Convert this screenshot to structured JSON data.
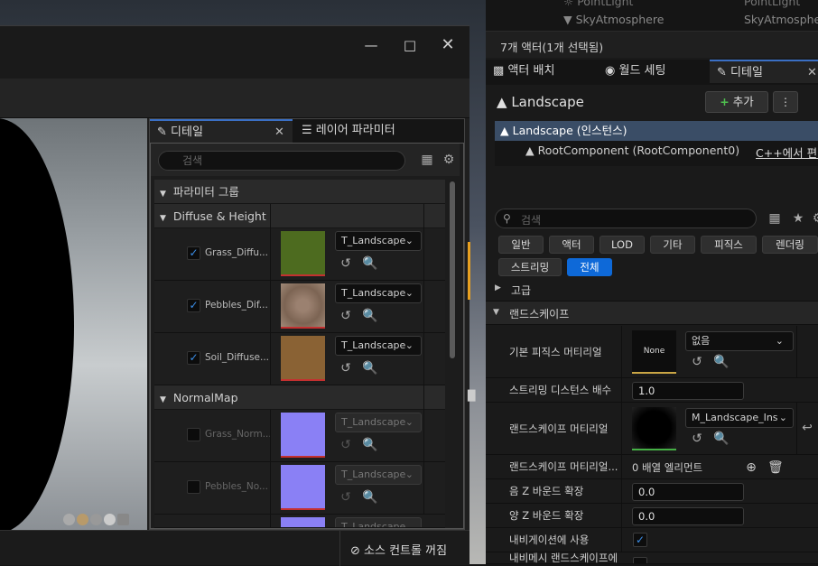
{
  "outliner": {
    "top_items": [
      {
        "name": "PointLight",
        "type": "PointLight"
      },
      {
        "name": "SkyAtmosphere",
        "type": "SkyAtmospher"
      }
    ],
    "status": "7개 액터(1개 선택됨)"
  },
  "right_tabs": [
    {
      "label": "액터 배치",
      "icon": "actor-place-icon"
    },
    {
      "label": "월드 세팅",
      "icon": "globe-icon"
    },
    {
      "label": "디테일",
      "icon": "pencil-icon"
    }
  ],
  "right_header": {
    "title": "Landscape",
    "add_label": "추가"
  },
  "component_tree": {
    "root": "Landscape (인스턴스)",
    "child": "RootComponent (RootComponent0)",
    "edit_link": "C++에서 편집"
  },
  "right_search": {
    "placeholder": "검색"
  },
  "filter_pills": {
    "row1": [
      "일반",
      "액터",
      "LOD",
      "기타",
      "피직스",
      "렌더링"
    ],
    "row2": [
      "스트리밍",
      "전체"
    ],
    "selected": "전체"
  },
  "sections": {
    "advanced": "고급",
    "landscape": "랜드스케이프"
  },
  "properties": [
    {
      "label": "기본 피직스 머티리얼",
      "thumb_text": "None",
      "value": "없음"
    },
    {
      "label": "스트리밍 디스턴스 배수",
      "value": "1.0"
    },
    {
      "label": "랜드스케이프 머티리얼",
      "value": "M_Landscape_Ins"
    },
    {
      "label": "랜드스케이프 머티리얼...",
      "value": "0 배열 엘리먼트"
    },
    {
      "label": "음 Z 바운드 확장",
      "value": "0.0"
    },
    {
      "label": "양 Z 바운드 확장",
      "value": "0.0"
    },
    {
      "label": "내비게이션에 사용",
      "checked": true
    },
    {
      "label": "내비메시 랜드스케이프에",
      "checked": false
    }
  ],
  "detail_panel": {
    "tab_detail": "디테일",
    "tab_layers": "레이어 파라미터",
    "search_placeholder": "검색",
    "group_header": "파라미터 그룹",
    "groups": [
      {
        "name": "Diffuse & Height",
        "items": [
          {
            "label": "Grass_Diffu...",
            "value": "T_Landscape",
            "checked": true,
            "color": "#4d6b1f"
          },
          {
            "label": "Pebbles_Dif...",
            "value": "T_Landscape",
            "checked": true,
            "color": "#8b7360"
          },
          {
            "label": "Soil_Diffuse...",
            "value": "T_Landscape",
            "checked": true,
            "color": "#8a6234"
          }
        ]
      },
      {
        "name": "NormalMap",
        "items": [
          {
            "label": "Grass_Norm...",
            "value": "T_Landscape",
            "checked": false,
            "color": "#8a80f5"
          },
          {
            "label": "Pebbles_No...",
            "value": "T_Landscape",
            "checked": false,
            "color": "#8a80f5"
          },
          {
            "label": "",
            "value": "T_Landscape",
            "checked": false,
            "color": "#8a80f5"
          }
        ]
      }
    ]
  },
  "bottom_bar": {
    "source_control": "소스 컨트롤 꺼짐"
  },
  "colors": {
    "accent": "#0e69d8",
    "selected_row": "#3a4d66"
  }
}
